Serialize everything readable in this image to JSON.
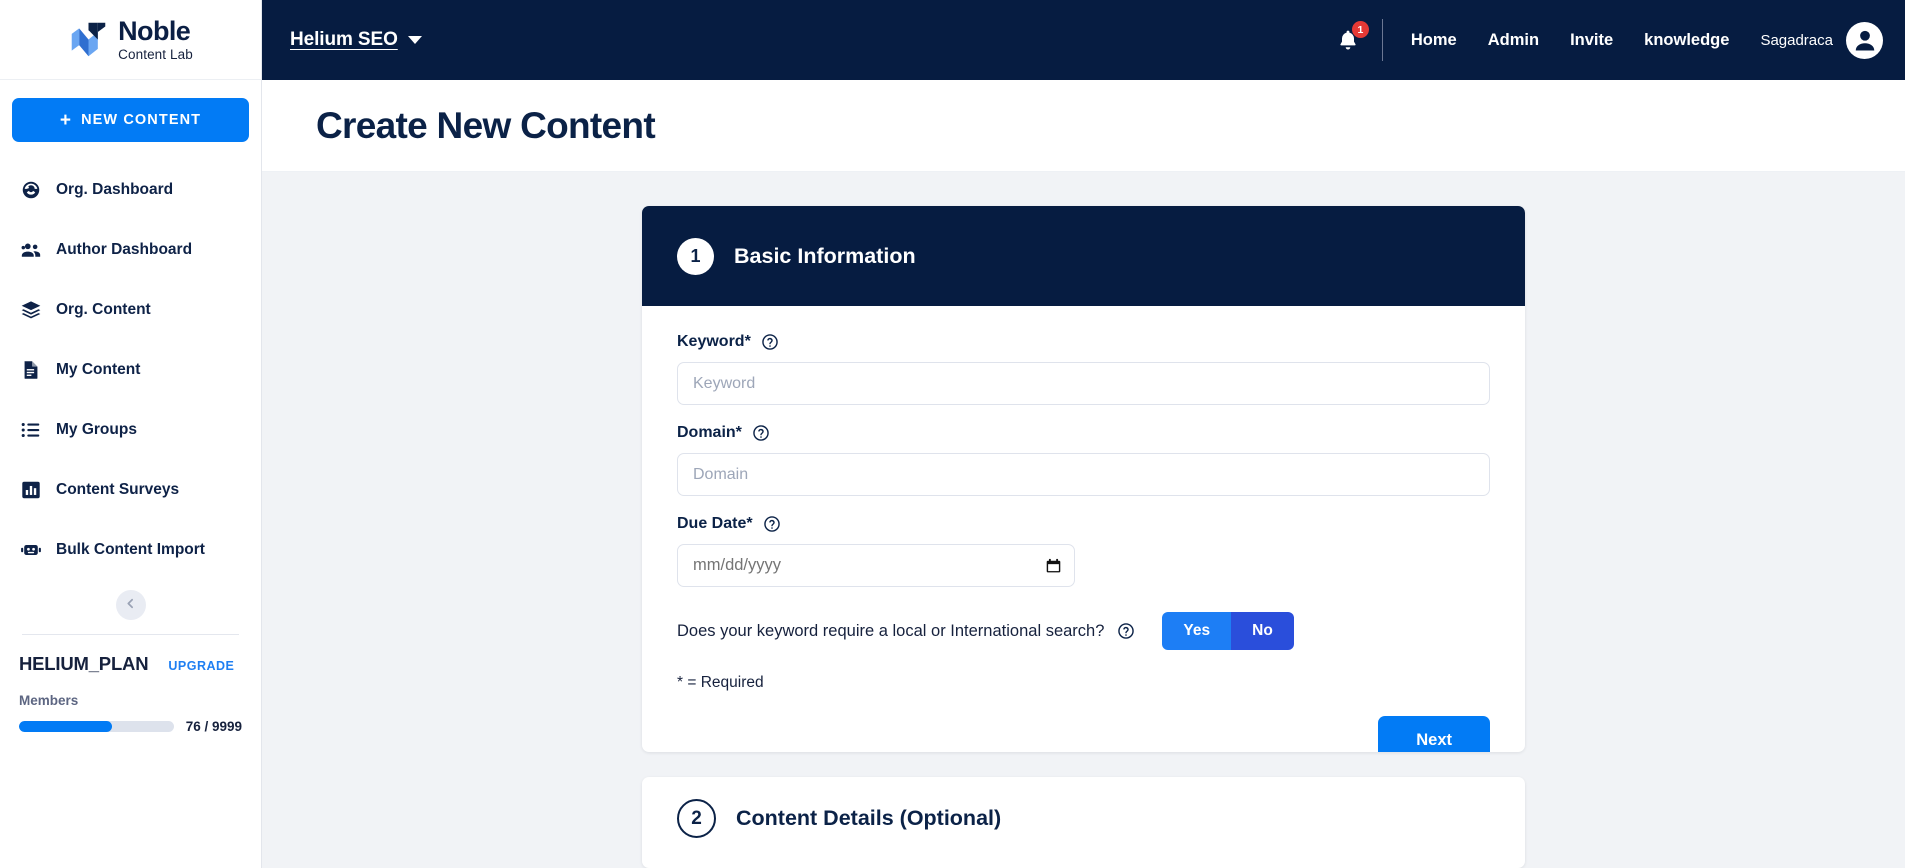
{
  "brand": {
    "name": "Noble",
    "subtitle": "Content Lab",
    "logo_icon": "noble-n-logo"
  },
  "sidebar": {
    "new_content_label": "NEW CONTENT",
    "items": [
      {
        "label": "Org. Dashboard",
        "icon": "speedometer-icon"
      },
      {
        "label": "Author Dashboard",
        "icon": "users-group-icon"
      },
      {
        "label": "Org. Content",
        "icon": "layers-icon"
      },
      {
        "label": "My Content",
        "icon": "document-icon"
      },
      {
        "label": "My Groups",
        "icon": "list-icon"
      },
      {
        "label": "Content Surveys",
        "icon": "bar-chart-icon"
      },
      {
        "label": "Bulk Content Import",
        "icon": "robot-icon"
      }
    ],
    "collapse_icon": "chevron-left-icon",
    "plan": {
      "name": "HELIUM_PLAN",
      "upgrade_label": "UPGRADE",
      "members_label": "Members",
      "members_count": "76 / 9999",
      "members_percent": 60
    }
  },
  "topbar": {
    "org_name": "Helium SEO",
    "org_caret_icon": "chevron-down-icon",
    "bell_icon": "bell-icon",
    "bell_badge": "1",
    "nav": [
      {
        "label": "Home"
      },
      {
        "label": "Admin"
      },
      {
        "label": "Invite"
      },
      {
        "label": "knowledge"
      }
    ],
    "user_name": "Sagadraca",
    "avatar_icon": "user-avatar-icon"
  },
  "page": {
    "title": "Create New Content"
  },
  "step1": {
    "number": "1",
    "title": "Basic Information",
    "keyword": {
      "label": "Keyword*",
      "placeholder": "Keyword",
      "value": "",
      "help_icon": "help-circle-icon"
    },
    "domain": {
      "label": "Domain*",
      "placeholder": "Domain",
      "value": "",
      "help_icon": "help-circle-icon"
    },
    "due_date": {
      "label": "Due Date*",
      "placeholder": "mm/dd/yyyy",
      "value": "",
      "help_icon": "help-circle-icon",
      "calendar_icon": "calendar-icon"
    },
    "search_question": {
      "text": "Does your keyword require a local or International search?",
      "help_icon": "help-circle-icon",
      "yes_label": "Yes",
      "no_label": "No",
      "selected": "No"
    },
    "required_note": "* = Required",
    "next_label": "Next"
  },
  "step2": {
    "number": "2",
    "title": "Content Details (Optional)"
  },
  "colors": {
    "navy": "#061c41",
    "accent_blue": "#027bf5",
    "toggle_yes": "#1d7ef5",
    "toggle_no": "#2a4edb",
    "badge_red": "#e53935",
    "page_bg": "#f1f3f6"
  }
}
